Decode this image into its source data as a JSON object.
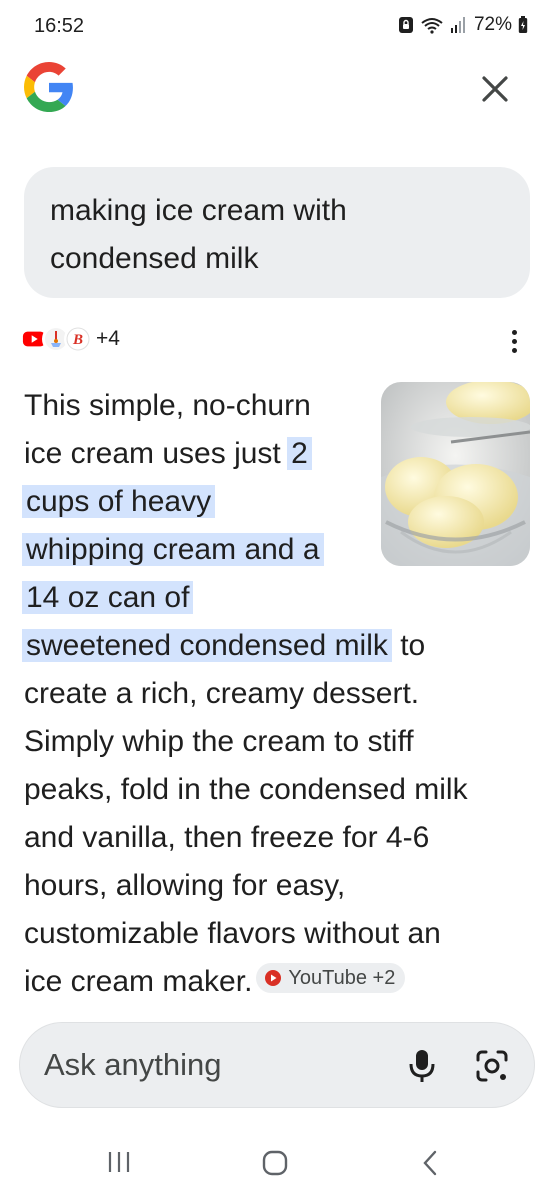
{
  "status_bar": {
    "time": "16:52",
    "battery": "72%",
    "icons": [
      "vpn-lock-icon",
      "wifi-icon",
      "signal-icon",
      "battery-icon"
    ]
  },
  "header": {
    "logo": "google-g-logo",
    "close_icon": "close-icon"
  },
  "query": {
    "lines": [
      "making ice cream with",
      "condensed milk"
    ]
  },
  "sources": {
    "icons": [
      "youtube-icon",
      "site-favicon-icon",
      "blog-favicon-icon"
    ],
    "more_label": "+4",
    "menu_icon": "more-vert-icon"
  },
  "answer": {
    "image": "ice-cream-bowl-image",
    "lines": [
      {
        "plain": "This simple, no-churn",
        "highlight": ""
      },
      {
        "plain": "ice cream uses just ",
        "highlight": "2"
      },
      {
        "plain": "",
        "highlight": "cups of heavy"
      },
      {
        "plain": "",
        "highlight": "whipping cream and a"
      },
      {
        "plain": "",
        "highlight": "14 oz can of"
      },
      {
        "plain": "",
        "highlight": "sweetened condensed milk",
        "after": " to"
      },
      {
        "plain": "create a rich, creamy dessert.",
        "highlight": ""
      },
      {
        "plain": "Simply whip the cream to stiff",
        "highlight": ""
      },
      {
        "plain": "peaks, fold in the condensed milk",
        "highlight": ""
      },
      {
        "plain": "and vanilla, then freeze for 4-6",
        "highlight": ""
      },
      {
        "plain": "hours, allowing for easy,",
        "highlight": ""
      },
      {
        "plain": "customizable flavors without an",
        "highlight": ""
      },
      {
        "plain": "ice cream maker.",
        "highlight": ""
      }
    ],
    "source_chip": "YouTube +2",
    "highlight_color": "#d3e3fd"
  },
  "ask_bar": {
    "placeholder": "Ask anything",
    "mic_icon": "mic-icon",
    "lens_icon": "google-lens-icon"
  },
  "nav_bar": {
    "icons": [
      "recents-icon",
      "home-icon",
      "back-icon"
    ]
  }
}
